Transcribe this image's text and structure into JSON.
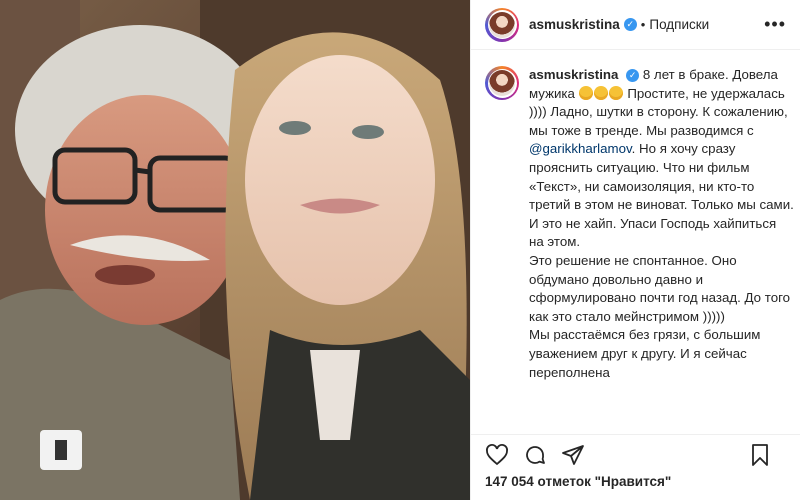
{
  "post": {
    "username": "asmuskristina",
    "follow_label": "Подписки",
    "caption_paragraphs": [
      "8 лет в браке. Довела мужика",
      "Простите, не удержалась )))) Ладно, шутки в сторону. К сожалению, мы тоже в тренде. Мы разводимся с",
      "@garikkharlamov",
      ". Но я хочу сразу прояснить ситуацию. Что ни фильм «Текст», ни самоизоляция, ни кто-то третий в этом не виноват. Только мы сами.",
      "И это не хайп. Упаси Господь хайпиться на этом.",
      "Это решение не спонтанное. Оно обдумано довольно давно и сформулировано почти год назад. До того как это стало мейнстримом )))))",
      "Мы расстаёмся без грязи, с большим уважением друг к другу. И я сейчас переполнена"
    ],
    "likes_text": "147 054 отметок \"Нравится\""
  },
  "icons": {
    "more": "more-icon",
    "heart": "heart-icon",
    "comment": "comment-icon",
    "share": "share-icon",
    "bookmark": "bookmark-icon",
    "verified": "verified-badge-icon"
  },
  "colors": {
    "verified": "#3897f0",
    "mention": "#00376b",
    "text": "#262626"
  }
}
